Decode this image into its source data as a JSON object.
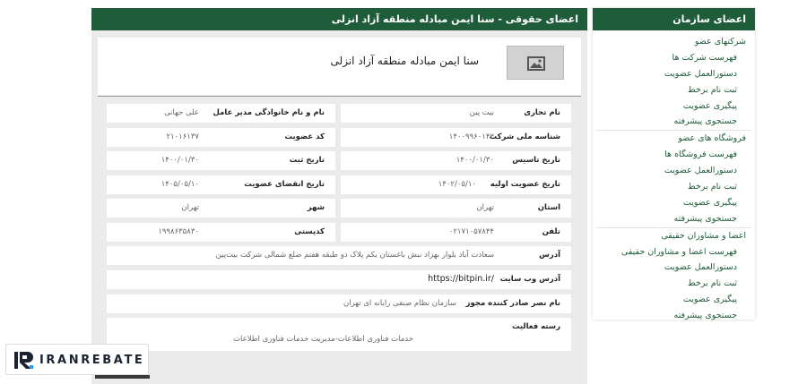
{
  "sidebar": {
    "title": "اعضای سازمان",
    "groups": [
      {
        "label": "شرکتهای عضو",
        "items": [
          "فهرست شرکت ها",
          "دستورالعمل عضویت",
          "ثبت نام برخط",
          "پیگیری عضویت",
          "جستجوی پیشرفته"
        ]
      },
      {
        "label": "فروشگاه های عضو",
        "items": [
          "فهرست فروشگاه ها",
          "دستورالعمل عضویت",
          "ثبت نام برخط",
          "پیگیری عضویت",
          "جستجوی پیشرفته"
        ]
      },
      {
        "label": "اعضا و مشاوران حقیقی",
        "items": [
          "فهرست اعضا و مشاوران حقیقی",
          "دستورالعمل عضویت",
          "ثبت نام برخط",
          "پیگیری عضویت",
          "جستجوی پیشرفته"
        ]
      }
    ]
  },
  "main": {
    "title": "اعضای حقوقی - سنا ایمن مبادله منطقه آزاد انزلی",
    "company_name": "سنا ایمن مبادله منطقه آزاد انزلی",
    "fields": {
      "trade_name": {
        "label": "نام تجاری",
        "value": "بیت پین"
      },
      "ceo": {
        "label": "نام و نام خانوادگی مدیر عامل",
        "value": "علی جهانی"
      },
      "national_id": {
        "label": "شناسه ملی شرکت",
        "value": "۱۴۰۰۹۹۶۰۱۴۲"
      },
      "member_code": {
        "label": "کد عضویت",
        "value": "۲۱۰۱۶۱۳۷"
      },
      "founded": {
        "label": "تاریخ تاسیس",
        "value": "۱۴۰۰/۰۱/۳۰"
      },
      "registered": {
        "label": "تاریخ ثبت",
        "value": "۱۴۰۰/۰۱/۳۰"
      },
      "first_membership": {
        "label": "تاریخ عضویت اولیه",
        "value": "۱۴۰۲/۰۵/۱۰"
      },
      "membership_expiry": {
        "label": "تاریخ انقضای عضویت",
        "value": "۱۴۰۵/۰۵/۱۰"
      },
      "province": {
        "label": "استان",
        "value": "تهران"
      },
      "city": {
        "label": "شهر",
        "value": "تهران"
      },
      "phone": {
        "label": "تلفن",
        "value": "۰۲۱۷۱۰۵۷۸۴۴"
      },
      "postal_code": {
        "label": "کدپستی",
        "value": "۱۹۹۸۶۳۵۸۳۰"
      },
      "address": {
        "label": "آدرس",
        "value": "سعادت آباد بلوار بهزاد نبش باغستان یکم پلاک دو طبقه هفتم ضلع شمالی شرکت بیت‌پین"
      },
      "website": {
        "label": "آدرس وب سایت",
        "value": "https://bitpin.ir/"
      },
      "license_authority": {
        "label": "نام نصر صادر کننده مجوز",
        "value": "سازمان نظام صنفی رایانه ای تهران"
      },
      "activity": {
        "label": "رسته فعالیت",
        "value": "خدمات فناوری اطلاعات-مدیریت خدمات فناوری اطلاعات"
      }
    }
  },
  "brand": {
    "name": "IRANREBATE",
    "icon": "iranrebate-logo-icon"
  },
  "colors": {
    "primary": "#1f5c3a",
    "panel_bg": "#ebebeb"
  }
}
